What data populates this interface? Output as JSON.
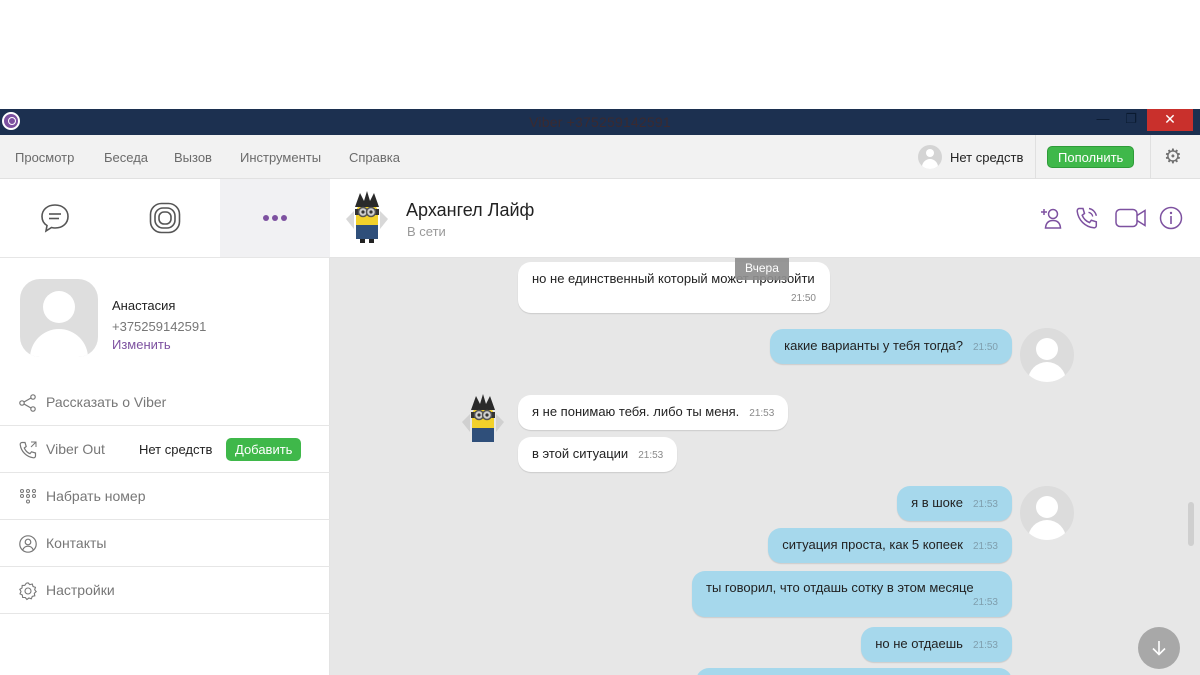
{
  "window": {
    "title": "Viber +375259142591"
  },
  "menu": {
    "items": [
      "Просмотр",
      "Беседа",
      "Вызов",
      "Инструменты",
      "Справка"
    ],
    "balance_text": "Нет средств",
    "topup_label": "Пополнить"
  },
  "sidebar": {
    "tabs": [
      "chats-icon",
      "calls-icon",
      "more-icon"
    ],
    "profile": {
      "name": "Анастасия",
      "phone": "+375259142591",
      "edit_label": "Изменить"
    },
    "items": [
      {
        "label": "Рассказать о Viber",
        "icon": "share-icon"
      },
      {
        "label": "Viber Out",
        "icon": "phone-out-icon",
        "status": "Нет средств",
        "button": "Добавить"
      },
      {
        "label": "Набрать номер",
        "icon": "dialpad-icon"
      },
      {
        "label": "Контакты",
        "icon": "contacts-icon"
      },
      {
        "label": "Настройки",
        "icon": "settings-icon"
      }
    ]
  },
  "chat": {
    "contact_name": "Архангел Лайф",
    "contact_status": "В сети",
    "day_badge": "Вчера",
    "messages": [
      {
        "dir": "in",
        "text": "но не единственный который может произойти",
        "time": "21:50"
      },
      {
        "dir": "out",
        "text": "какие варианты у тебя тогда?",
        "time": "21:50"
      },
      {
        "dir": "in",
        "text": "я не понимаю тебя. либо ты меня.",
        "time": "21:53"
      },
      {
        "dir": "in",
        "text": "в этой ситуации",
        "time": "21:53"
      },
      {
        "dir": "out",
        "text": "я в шоке",
        "time": "21:53"
      },
      {
        "dir": "out",
        "text": "ситуация проста, как 5 копеек",
        "time": "21:53"
      },
      {
        "dir": "out",
        "text": "ты говорил, что отдашь сотку в этом месяце",
        "time": "21:53"
      },
      {
        "dir": "out",
        "text": "но не отдаешь",
        "time": "21:53"
      }
    ]
  },
  "colors": {
    "titlebar": "#1c3050",
    "accent": "#7d51a0",
    "green": "#3fb84a",
    "outgoing_bubble": "#a6d8ec",
    "incoming_bubble": "#ffffff",
    "chat_bg": "#e7e7e7"
  }
}
